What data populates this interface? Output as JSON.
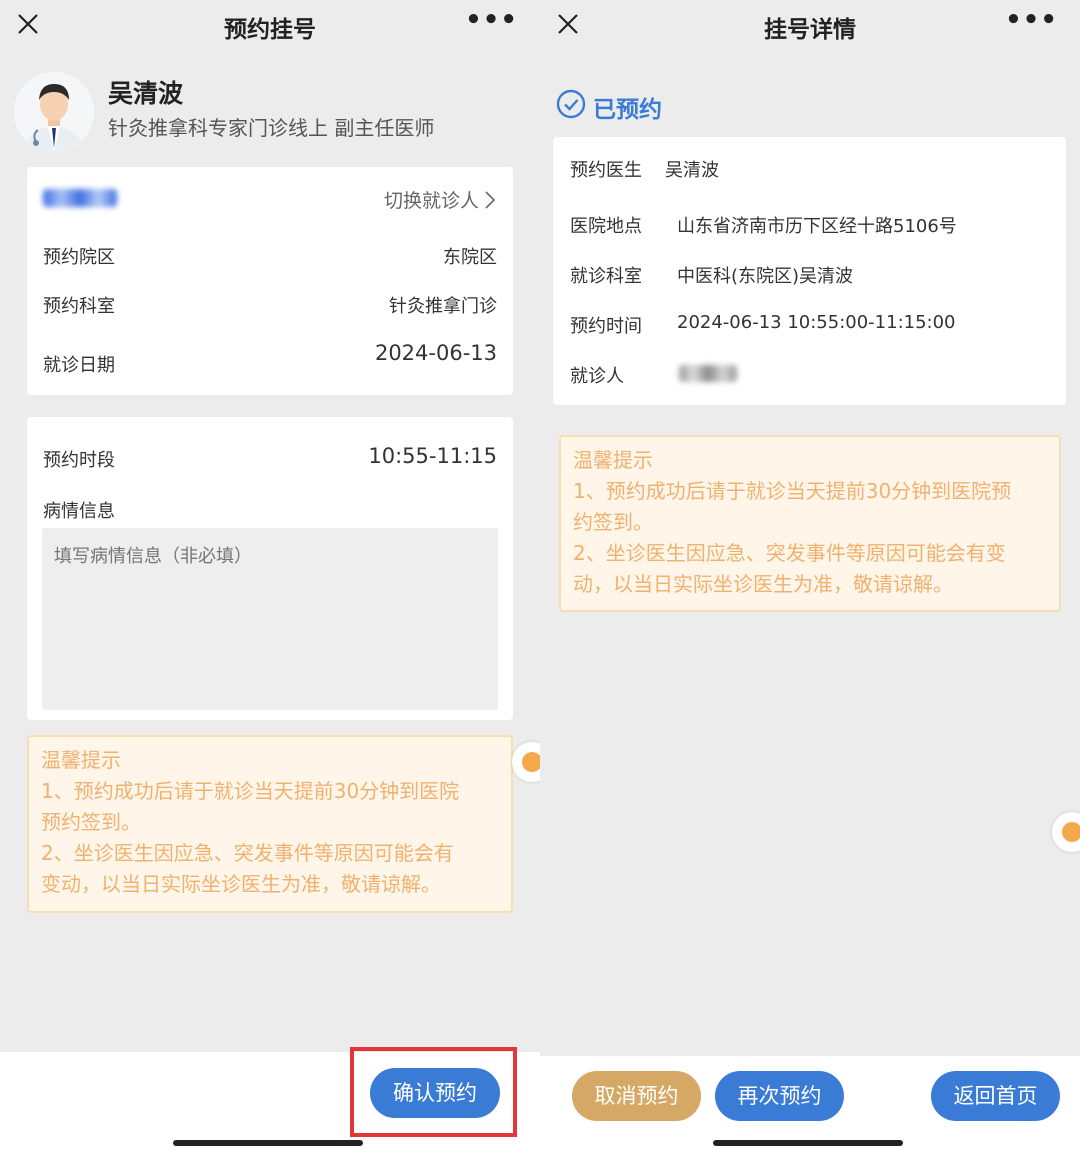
{
  "left": {
    "nav": {
      "title": "预约挂号",
      "more": "•••"
    },
    "doctor": {
      "name": "吴清波",
      "desc": "针灸推拿科专家门诊线上 副主任医师"
    },
    "patient": {
      "switch_label": "切换就诊人"
    },
    "info": {
      "rows": [
        {
          "label": "预约院区",
          "value": "东院区"
        },
        {
          "label": "预约科室",
          "value": "针灸推拿门诊"
        },
        {
          "label": "就诊日期",
          "value": "2024-06-13"
        }
      ]
    },
    "slot": {
      "label": "预约时段",
      "value": "10:55-11:15"
    },
    "condition": {
      "label": "病情信息",
      "placeholder": "填写病情信息（非必填）"
    },
    "tips": {
      "title": "温馨提示",
      "line1": "1、预约成功后请于就诊当天提前30分钟到医院",
      "line2": "预约签到。",
      "line3": "2、坐诊医生因应急、突发事件等原因可能会有",
      "line4": "变动，以当日实际坐诊医生为准，敬请谅解。"
    },
    "confirm_button": "确认预约"
  },
  "right": {
    "nav": {
      "title": "挂号详情",
      "more": "•••"
    },
    "status": "已预约",
    "details": [
      {
        "label": "预约医生",
        "value": "吴清波"
      },
      {
        "label": "医院地点",
        "value": "山东省济南市历下区经十路5106号"
      },
      {
        "label": "就诊科室",
        "value": "中医科(东院区)吴清波"
      },
      {
        "label": "预约时间",
        "value": "2024-06-13 10:55:00-11:15:00"
      },
      {
        "label": "就诊人",
        "value": ""
      }
    ],
    "tips": {
      "title": "温馨提示",
      "line1": "1、预约成功后请于就诊当天提前30分钟到医院预",
      "line2": "约签到。",
      "line3": "2、坐诊医生因应急、突发事件等原因可能会有变",
      "line4": "动，以当日实际坐诊医生为准，敬请谅解。"
    },
    "buttons": {
      "cancel": "取消预约",
      "again": "再次预约",
      "home": "返回首页"
    }
  },
  "colors": {
    "primary_blue": "#3a7bd5",
    "cancel_gold": "#d6a865",
    "tip_text": "#f0b16f",
    "highlight_red": "#e5353b"
  }
}
